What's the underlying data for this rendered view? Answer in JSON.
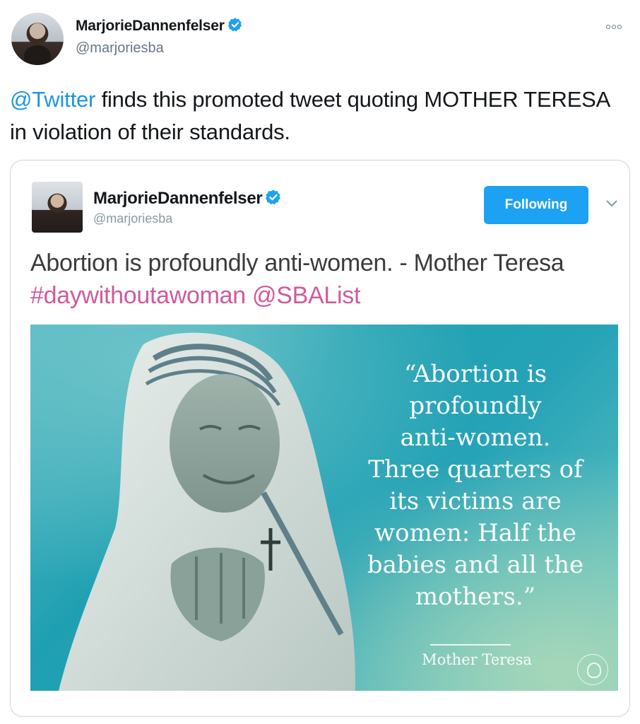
{
  "tweet": {
    "author_name": "MarjorieDannenfelser",
    "author_handle": "@marjoriesba",
    "text_mention": "@Twitter",
    "text_body": " finds this promoted tweet quoting MOTHER TERESA in violation of their standards."
  },
  "quoted_tweet": {
    "author_name": "MarjorieDannenfelser",
    "author_handle": "@marjoriesba",
    "follow_label": "Following",
    "text_plain": "Abortion is profoundly anti-women. - Mother Teresa ",
    "hashtag": "#daywithoutawoman",
    "mention": "@SBAList"
  },
  "quote_image": {
    "quote_lines": [
      "“Abortion is",
      "profoundly",
      "anti-women.",
      "Three quarters of",
      "its victims are",
      "women: Half the",
      "babies and all the",
      "mothers.”"
    ],
    "attribution": "Mother Teresa"
  },
  "icons": {
    "verified": "verified-badge-icon",
    "more": "more-options-icon",
    "chevron": "chevron-down-icon"
  },
  "colors": {
    "link": "#1b95e0",
    "hashtag": "#d05a9c",
    "follow_button": "#1da1f2",
    "handle": "#657786"
  }
}
